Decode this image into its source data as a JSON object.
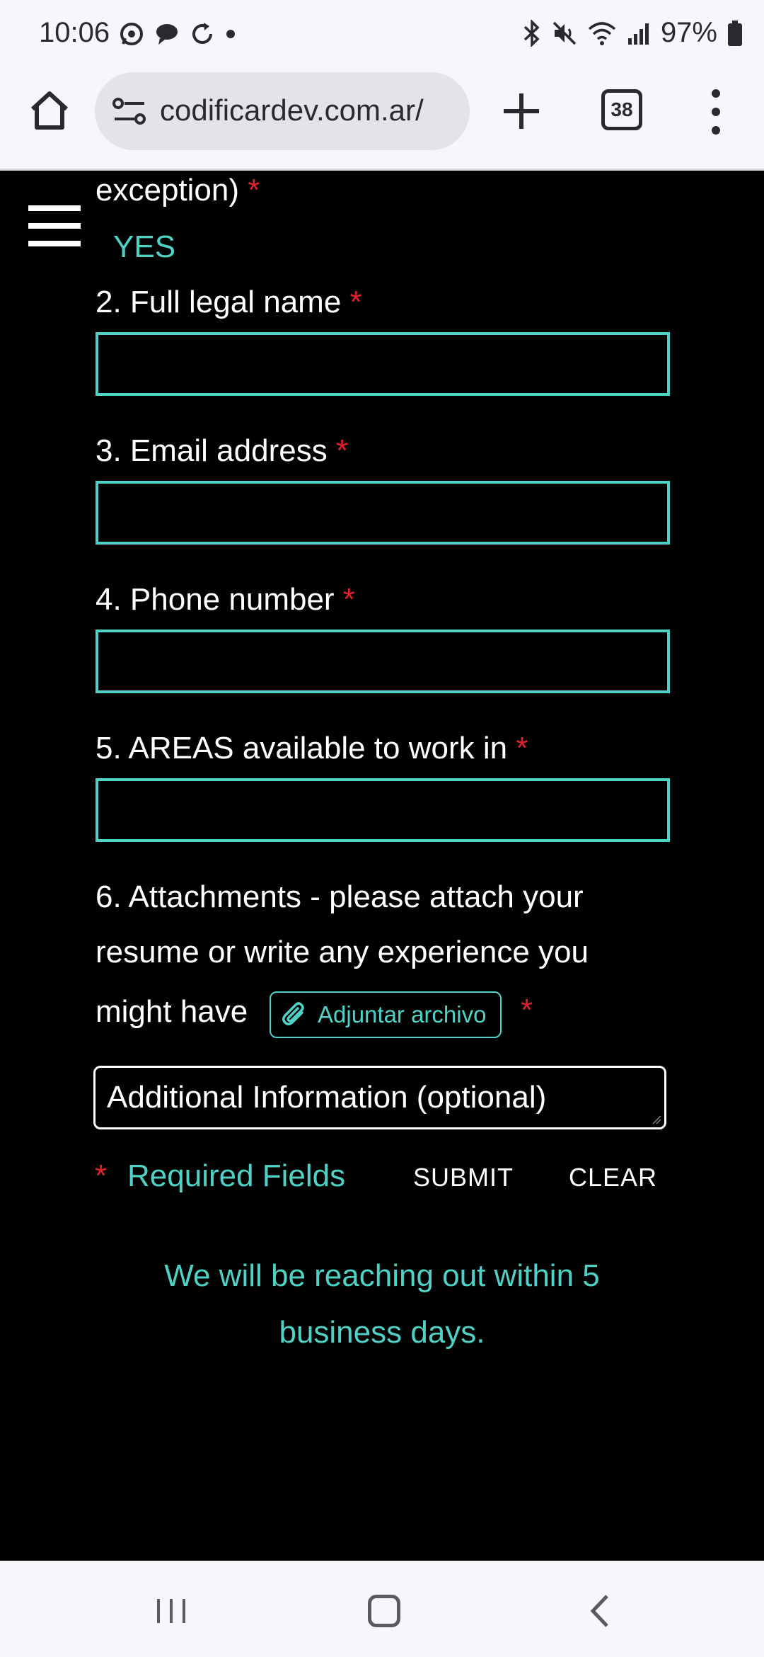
{
  "status_bar": {
    "time": "10:06",
    "battery": "97%",
    "left_icons": [
      "whatsapp-icon",
      "chat-icon",
      "sync-icon",
      "dot-icon"
    ],
    "right_icons": [
      "bluetooth-icon",
      "mute-icon",
      "wifi-icon",
      "signal-icon",
      "battery-icon"
    ]
  },
  "browser": {
    "url": "codificardev.com.ar/",
    "tab_count": "38"
  },
  "form": {
    "q1_tail": "exception)",
    "q1_answer": "YES",
    "q2_label": "2. Full legal name",
    "q3_label": "3. Email address",
    "q4_label": "4. Phone number",
    "q5_label": "5. AREAS available to work in",
    "q6_line1": "6. Attachments - please attach your",
    "q6_line2": "resume or write any experience you",
    "q6_line3": "might have",
    "attach_button": "Adjuntar archivo",
    "additional_info_placeholder": "Additional Information (optional)",
    "required_marker": "*",
    "required_fields_label": "Required Fields",
    "submit_label": "SUBMIT",
    "clear_label": "CLEAR",
    "note": "We will be reaching out within 5 business days."
  },
  "colors": {
    "accent": "#4fd1c5",
    "required": "#e0202c",
    "background": "#000000",
    "chrome": "#f7f6fb"
  }
}
